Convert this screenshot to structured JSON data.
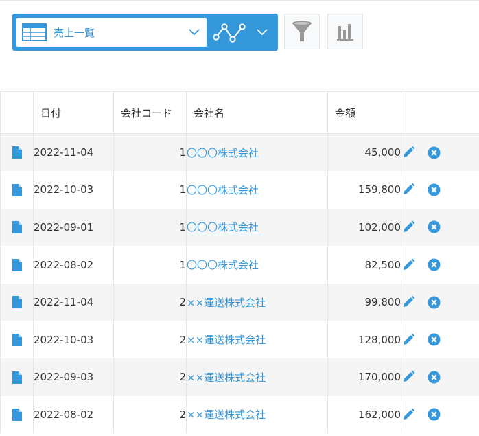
{
  "toolbar": {
    "view_label": "売上一覧",
    "colors": {
      "accent": "#3498db",
      "tool_icon": "#999999"
    }
  },
  "table": {
    "headers": {
      "date": "日付",
      "company_code": "会社コード",
      "company_name": "会社名",
      "amount": "金額"
    },
    "rows": [
      {
        "date": "2022-11-04",
        "code": "1",
        "name": "〇〇〇株式会社",
        "amount": "45,000"
      },
      {
        "date": "2022-10-03",
        "code": "1",
        "name": "〇〇〇株式会社",
        "amount": "159,800"
      },
      {
        "date": "2022-09-01",
        "code": "1",
        "name": "〇〇〇株式会社",
        "amount": "102,000"
      },
      {
        "date": "2022-08-02",
        "code": "1",
        "name": "〇〇〇株式会社",
        "amount": "82,500"
      },
      {
        "date": "2022-11-04",
        "code": "2",
        "name": "××運送株式会社",
        "amount": "99,800"
      },
      {
        "date": "2022-10-03",
        "code": "2",
        "name": "××運送株式会社",
        "amount": "128,000"
      },
      {
        "date": "2022-09-03",
        "code": "2",
        "name": "××運送株式会社",
        "amount": "170,000"
      },
      {
        "date": "2022-08-02",
        "code": "2",
        "name": "××運送株式会社",
        "amount": "162,000"
      }
    ]
  },
  "icons": {
    "row_detail": "document-icon",
    "row_edit": "pencil-icon",
    "row_delete": "delete-circle-icon",
    "view": "table-icon",
    "graph": "line-graph-icon",
    "filter": "filter-funnel-icon",
    "summary": "bar-chart-icon"
  }
}
